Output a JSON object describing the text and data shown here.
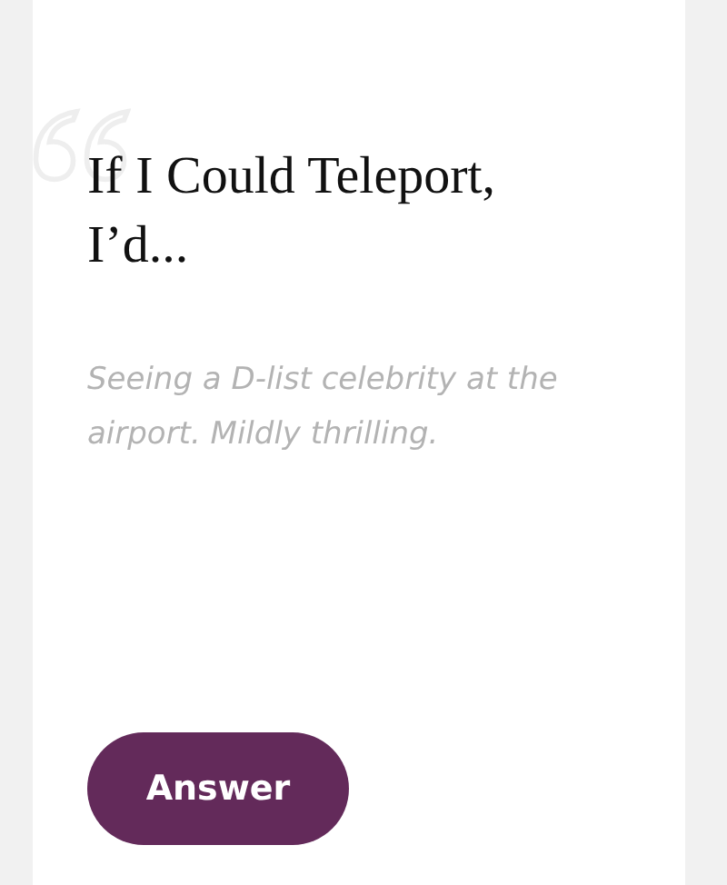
{
  "card": {
    "title": "If I Could Teleport, I’d...",
    "answer": "Seeing a D-list celebrity at the airport. Mildly thrilling.",
    "button": "Answer"
  }
}
